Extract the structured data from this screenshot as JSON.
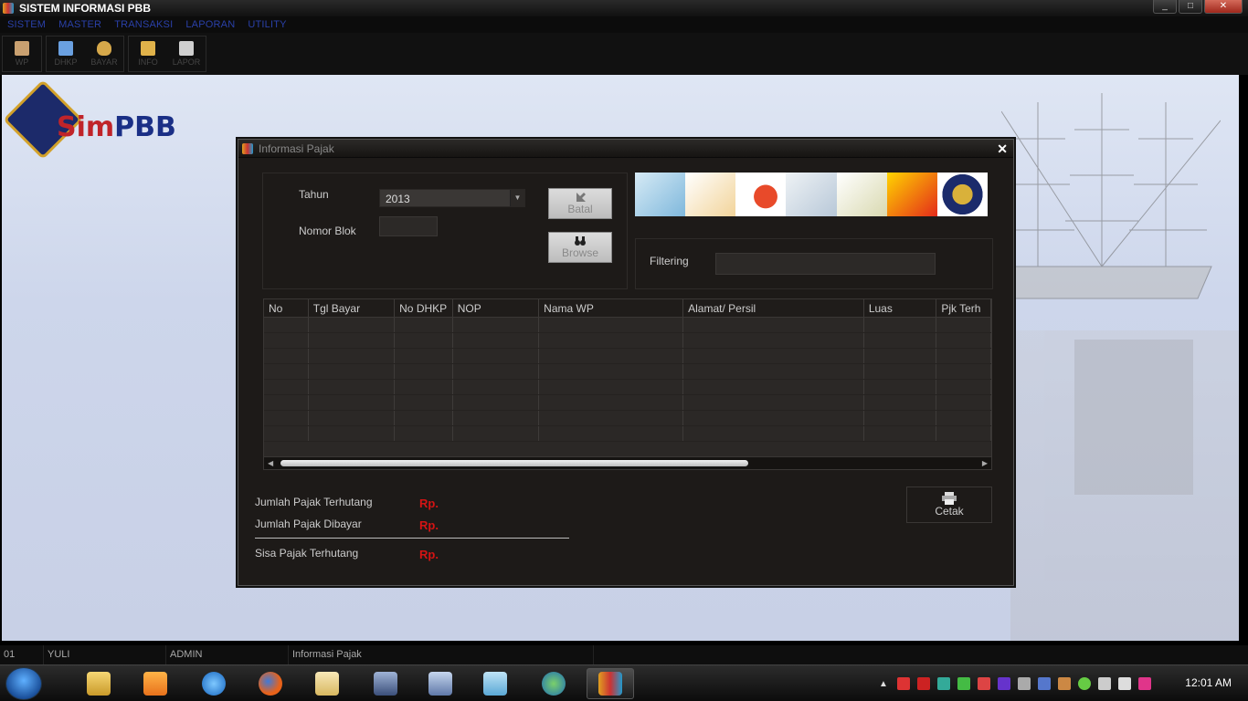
{
  "window": {
    "title": "SISTEM INFORMASI PBB",
    "minimize": "_",
    "maximize": "□",
    "close": "✕"
  },
  "menu": [
    "SISTEM",
    "MASTER",
    "TRANSAKSI",
    "LAPORAN",
    "UTILITY"
  ],
  "toolbar": [
    {
      "label": "WP",
      "icon": "user-icon",
      "color": "#c9a070"
    },
    {
      "label": "DHKP",
      "icon": "documents-icon",
      "color": "#6aa0e0"
    },
    {
      "label": "BAYAR",
      "icon": "money-bag-icon",
      "color": "#d6a84a"
    },
    {
      "label": "INFO",
      "icon": "info-card-icon",
      "color": "#e0b24a"
    },
    {
      "label": "LAPOR",
      "icon": "report-edit-icon",
      "color": "#cfcfcf"
    }
  ],
  "logo": {
    "part1": "Sim",
    "part2": "PBB"
  },
  "dialog": {
    "title": "Informasi Pajak",
    "close": "✕",
    "tahun_label": "Tahun",
    "tahun_value": "2013",
    "nomor_blok_label": "Nomor Blok",
    "nomor_blok_value": "",
    "batal_label": "Batal",
    "browse_label": "Browse",
    "filtering_label": "Filtering",
    "filtering_value": "",
    "columns": [
      "No",
      "Tgl Bayar",
      "No DHKP",
      "NOP",
      "Nama WP",
      "Alamat/ Persil",
      "Luas",
      "Pjk Terh"
    ],
    "summary": {
      "terhutang_label": "Jumlah Pajak Terhutang",
      "terhutang_value": "Rp.",
      "dibayar_label": "Jumlah Pajak Dibayar",
      "dibayar_value": "Rp.",
      "sisa_label": "Sisa Pajak Terhutang",
      "sisa_value": "Rp."
    },
    "cetak_label": "Cetak"
  },
  "statusbar": [
    "01",
    "YULI",
    "ADMIN",
    "Informasi Pajak"
  ],
  "taskbar": {
    "apps": [
      "explorer-folder-icon",
      "media-player-icon",
      "internet-explorer-icon",
      "firefox-icon",
      "notepad-icon",
      "monitor-icon",
      "window-switch-icon",
      "desktop-icon",
      "globe-icon",
      "simpbb-app-icon"
    ],
    "clock": "12:01 AM"
  },
  "colors": {
    "accent_red": "#d41414",
    "menu_blue": "#2a40a8"
  }
}
